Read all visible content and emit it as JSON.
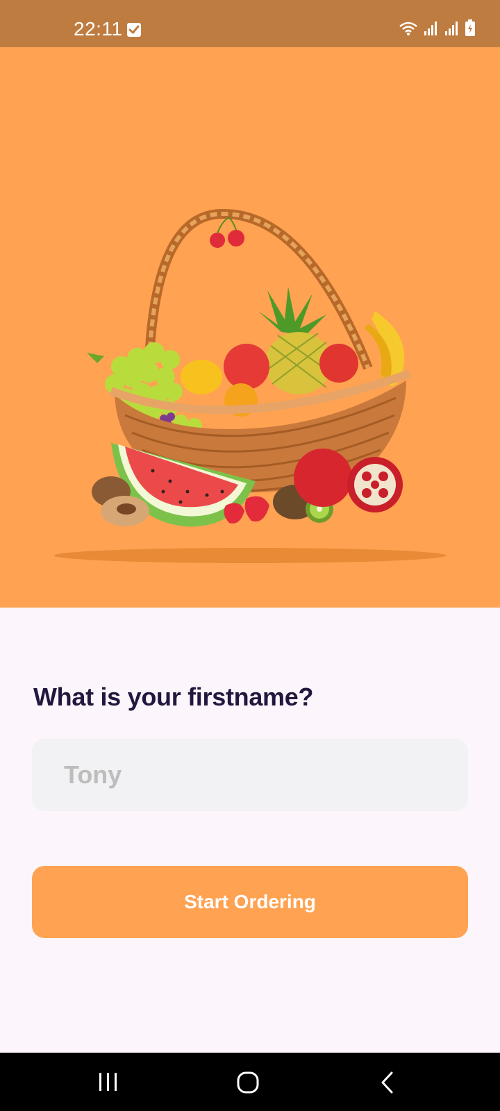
{
  "status_bar": {
    "time": "22:11",
    "icons": [
      "check-icon",
      "wifi-icon",
      "signal-icon",
      "signal-icon",
      "battery-charging-icon"
    ]
  },
  "hero": {
    "image": "fruit-basket-illustration",
    "background_color": "#ffa252"
  },
  "form": {
    "question": "What is your firstname?",
    "name_placeholder": "Tony",
    "name_value": "",
    "start_button_label": "Start Ordering"
  },
  "colors": {
    "accent": "#ffa252",
    "status_bar": "#bf7c40",
    "heading": "#22183e",
    "input_bg": "#f2f1f3"
  },
  "nav_bar": {
    "icons": [
      "recent-apps-icon",
      "home-icon",
      "back-icon"
    ]
  }
}
